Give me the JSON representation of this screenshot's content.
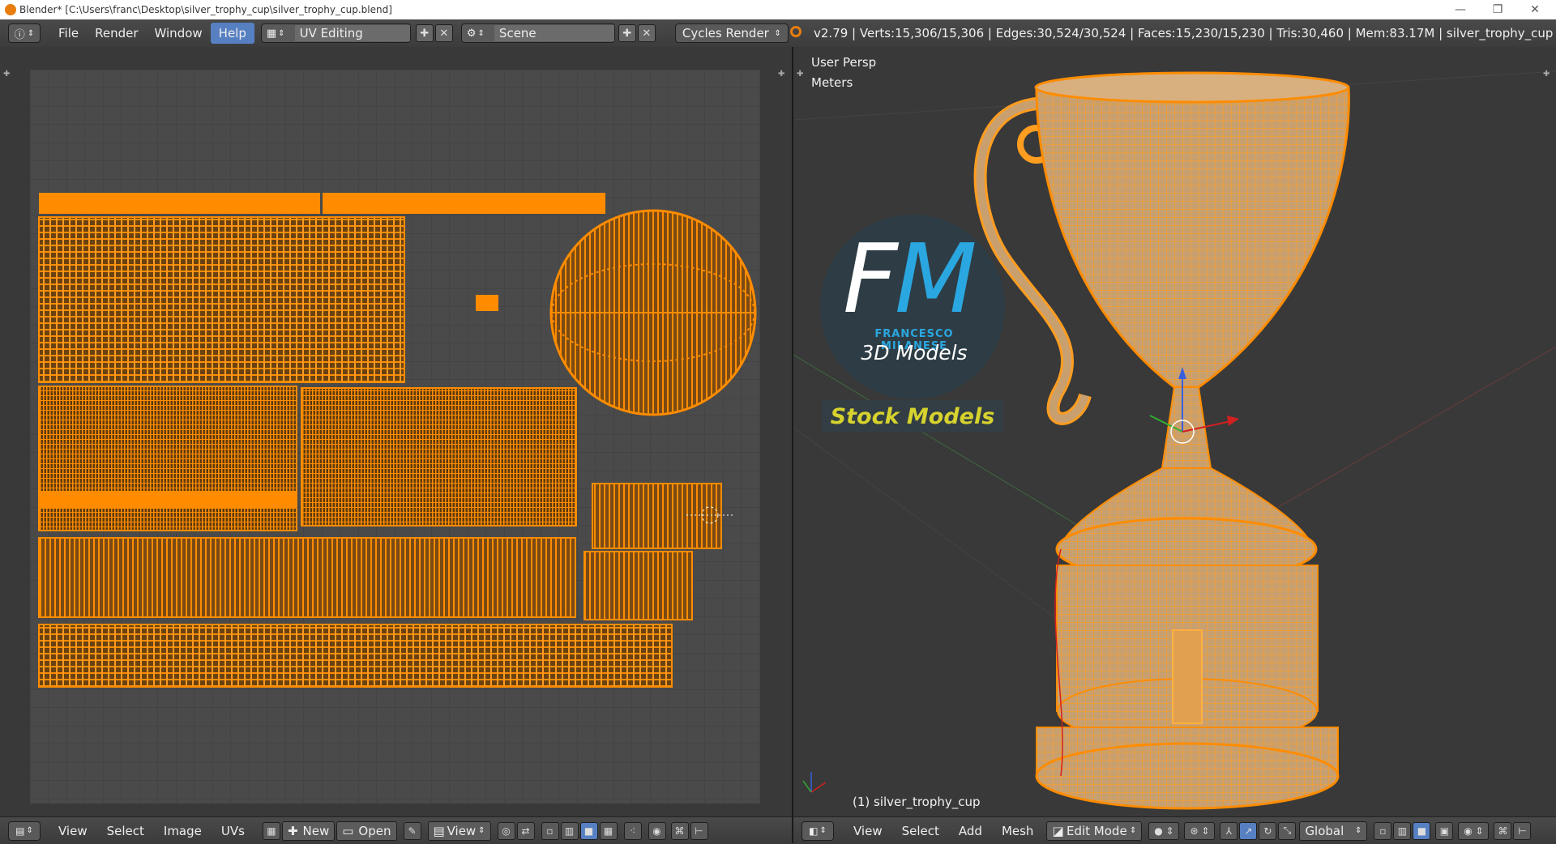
{
  "window": {
    "title": "Blender* [C:\\Users\\franc\\Desktop\\silver_trophy_cup\\silver_trophy_cup.blend]",
    "minimize": "—",
    "restore": "❐",
    "close": "✕"
  },
  "info_header": {
    "menus": [
      "File",
      "Render",
      "Window",
      "Help"
    ],
    "screen_layout": "UV Editing",
    "scene": "Scene",
    "render_engine": "Cycles Render",
    "stats": "v2.79 | Verts:15,306/15,306 | Edges:30,524/30,524 | Faces:15,230/15,230 | Tris:30,460 | Mem:83.17M | silver_trophy_cup"
  },
  "uv_editor_header": {
    "menus": [
      "View",
      "Select",
      "Image",
      "UVs"
    ],
    "new_label": "New",
    "open_label": "Open",
    "view_label": "View"
  },
  "viewport": {
    "view_label": "User Persp",
    "units_label": "Meters",
    "object_label": "(1) silver_trophy_cup",
    "header_menus": [
      "View",
      "Select",
      "Add",
      "Mesh"
    ],
    "mode": "Edit Mode",
    "orientation": "Global"
  },
  "logo": {
    "letter_f": "F",
    "letter_m": "M",
    "name": "FRANCESCO MILANESE",
    "subtitle": "3D Models",
    "tagline": "Stock Models"
  },
  "colors": {
    "uv_orange": "#ff8c00",
    "mesh_orange": "#f2a33a",
    "active_blue": "#5680c2",
    "logo_blue": "#2aa7e0",
    "logo_yellow": "#d6d22e"
  }
}
